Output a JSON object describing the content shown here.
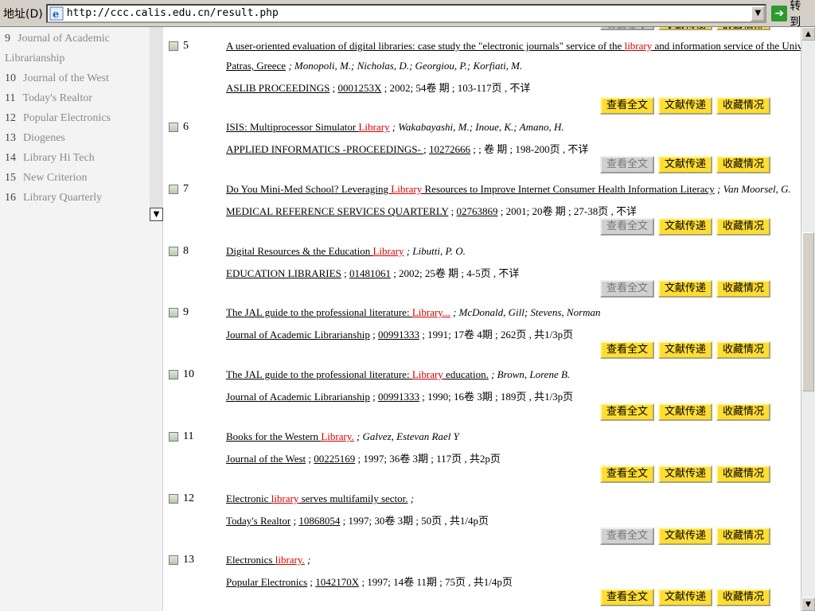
{
  "address_bar": {
    "label": "地址(D)",
    "url": "http://ccc.calis.edu.cn/result.php",
    "go_label": "转到"
  },
  "sidebar": {
    "items": [
      {
        "num": "9",
        "label": "Journal of Academic",
        "cont": "Librarianship"
      },
      {
        "num": "10",
        "label": "Journal of the West"
      },
      {
        "num": "11",
        "label": "Today's Realtor"
      },
      {
        "num": "12",
        "label": "Popular Electronics"
      },
      {
        "num": "13",
        "label": "Diogenes"
      },
      {
        "num": "14",
        "label": "Library Hi Tech"
      },
      {
        "num": "15",
        "label": "New Criterion"
      },
      {
        "num": "16",
        "label": "Library Quarterly"
      }
    ]
  },
  "buttons": {
    "fulltext": "查看全文",
    "delivery": "文献传递",
    "holdings": "收藏情况"
  },
  "records": [
    {
      "num": "5",
      "title_a": "A user-oriented evaluation of digital libraries: case study the \"electronic journals\" service of the ",
      "title_hl": "library",
      "title_b": " and information service of the University of",
      "title_c": "Patras, Greece",
      "authors": " ; Monopoli, M.; Nicholas, D.; Georgiou, P.; Korfiati, M.",
      "journal": "ASLIB PROCEEDINGS",
      "issn": "0001253X",
      "info": " ; 2002; 54卷  期  ; 103-117页  , 不详",
      "fulltext_enabled": true
    },
    {
      "num": "6",
      "title_a": "ISIS: Multiprocessor Simulator ",
      "title_hl": "Library",
      "title_b": "",
      "authors": " ; Wakabayashi, M.; Inoue, K.; Amano, H.",
      "journal": "APPLIED INFORMATICS -PROCEEDINGS- ",
      "issn": "10272666",
      "info": " ; ; 卷  期  ; 198-200页  , 不详",
      "fulltext_enabled": false
    },
    {
      "num": "7",
      "title_a": "Do You Mini-Med School? Leveraging ",
      "title_hl": "Library",
      "title_b": " Resources to Improve Internet Consumer Health Information Literacy",
      "authors": " ; Van Moorsel, G.",
      "journal": "MEDICAL REFERENCE SERVICES QUARTERLY",
      "issn": "02763869",
      "info": " ; 2001; 20卷  期  ; 27-38页  , 不详",
      "fulltext_enabled": false
    },
    {
      "num": "8",
      "title_a": "Digital Resources & the Education ",
      "title_hl": "Library",
      "title_b": "",
      "authors": " ; Libutti, P. O.",
      "journal": "EDUCATION LIBRARIES",
      "issn": "01481061",
      "info": " ; 2002; 25卷  期  ; 4-5页  , 不详",
      "fulltext_enabled": false
    },
    {
      "num": "9",
      "title_a": "The JAL guide to the professional literature: ",
      "title_hl": "Library...",
      "title_b": "",
      "authors": " ; McDonald, Gill; Stevens, Norman",
      "journal": "Journal of Academic Librarianship",
      "issn": "00991333",
      "info": " ; 1991; 17卷  4期  ; 262页  , 共1/3p页",
      "fulltext_enabled": true
    },
    {
      "num": "10",
      "title_a": "The JAL guide to the professional literature: ",
      "title_hl": "Library",
      "title_b": " education.",
      "authors": " ; Brown, Lorene B.",
      "journal": "Journal of Academic Librarianship",
      "issn": "00991333",
      "info": " ; 1990; 16卷  3期  ; 189页  , 共1/3p页",
      "fulltext_enabled": true
    },
    {
      "num": "11",
      "title_a": "Books for the Western ",
      "title_hl": "Library.",
      "title_b": "",
      "authors": " ; Galvez, Estevan Rael Y",
      "journal": "Journal of the West",
      "issn": "00225169",
      "info": " ; 1997; 36卷  3期  ; 117页  , 共2p页",
      "fulltext_enabled": true
    },
    {
      "num": "12",
      "title_a": "Electronic ",
      "title_hl": "library",
      "title_b": " serves multifamily sector.",
      "authors": " ;",
      "journal": "Today's Realtor",
      "issn": "10868054",
      "info": " ; 1997; 30卷  3期  ; 50页  , 共1/4p页",
      "fulltext_enabled": false
    },
    {
      "num": "13",
      "title_a": "Electronics ",
      "title_hl": "library.",
      "title_b": "",
      "authors": " ;",
      "journal": "Popular Electronics",
      "issn": "1042170X",
      "info": " ; 1997; 14卷  11期  ; 75页  , 共1/4p页",
      "fulltext_enabled": true
    }
  ]
}
